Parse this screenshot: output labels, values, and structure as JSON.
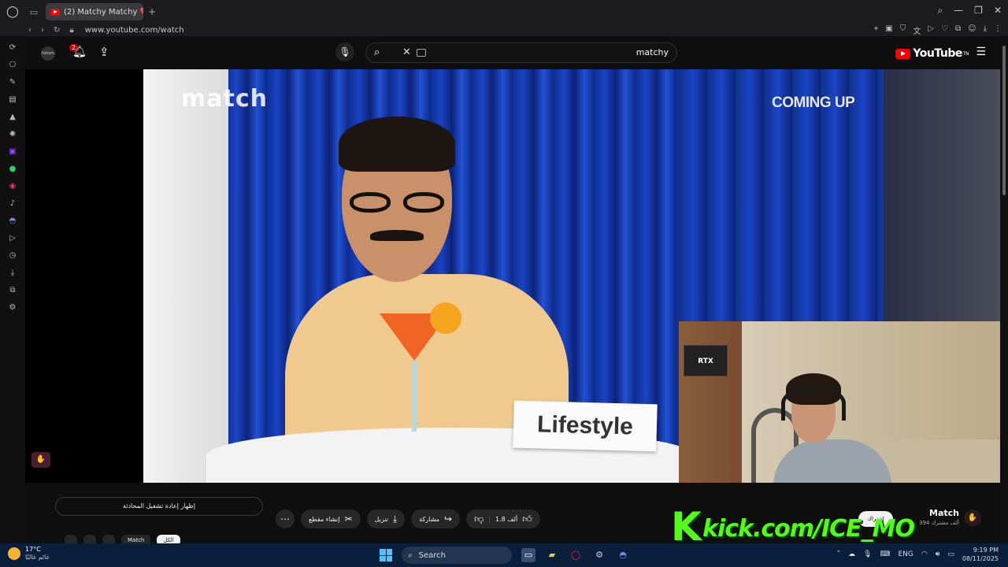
{
  "browser": {
    "tab_title": "(2) Matchy Matchy 💔 Ep",
    "new_tab": "+",
    "url": "www.youtube.com/watch"
  },
  "youtube": {
    "channel_icon_text": "fotiom",
    "notification_count": "2",
    "search_query": "matchy",
    "logo_text": "YouTube",
    "logo_tm": "TN"
  },
  "video": {
    "watermark": "match",
    "nameplate": "Lifestyle",
    "coming_up": "COMING UP",
    "gpu_label": "RTX"
  },
  "overlay": {
    "kick_url": "kick.com/ICE_MO"
  },
  "below": {
    "show_chat": "إظهار إعادة تشغيل المحادثة",
    "like_count": "1.8 ألف",
    "share": "مشاركة",
    "download": "تنزيل",
    "clip": "إنشاء مقطع",
    "subscribe": "اشتراك",
    "channel_name": "Match",
    "channel_subs": "394 ألف مشترك",
    "chips": [
      "الكل",
      "Match",
      "",
      "",
      ""
    ]
  },
  "taskbar": {
    "temp": "17°C",
    "condition": "غائم غالبًا",
    "search": "Search",
    "lang": "ENG",
    "time": "9:19 PM",
    "date": "08/11/2025"
  },
  "colors": {
    "accent_red": "#ff0000",
    "kick_green": "#53fc18"
  }
}
